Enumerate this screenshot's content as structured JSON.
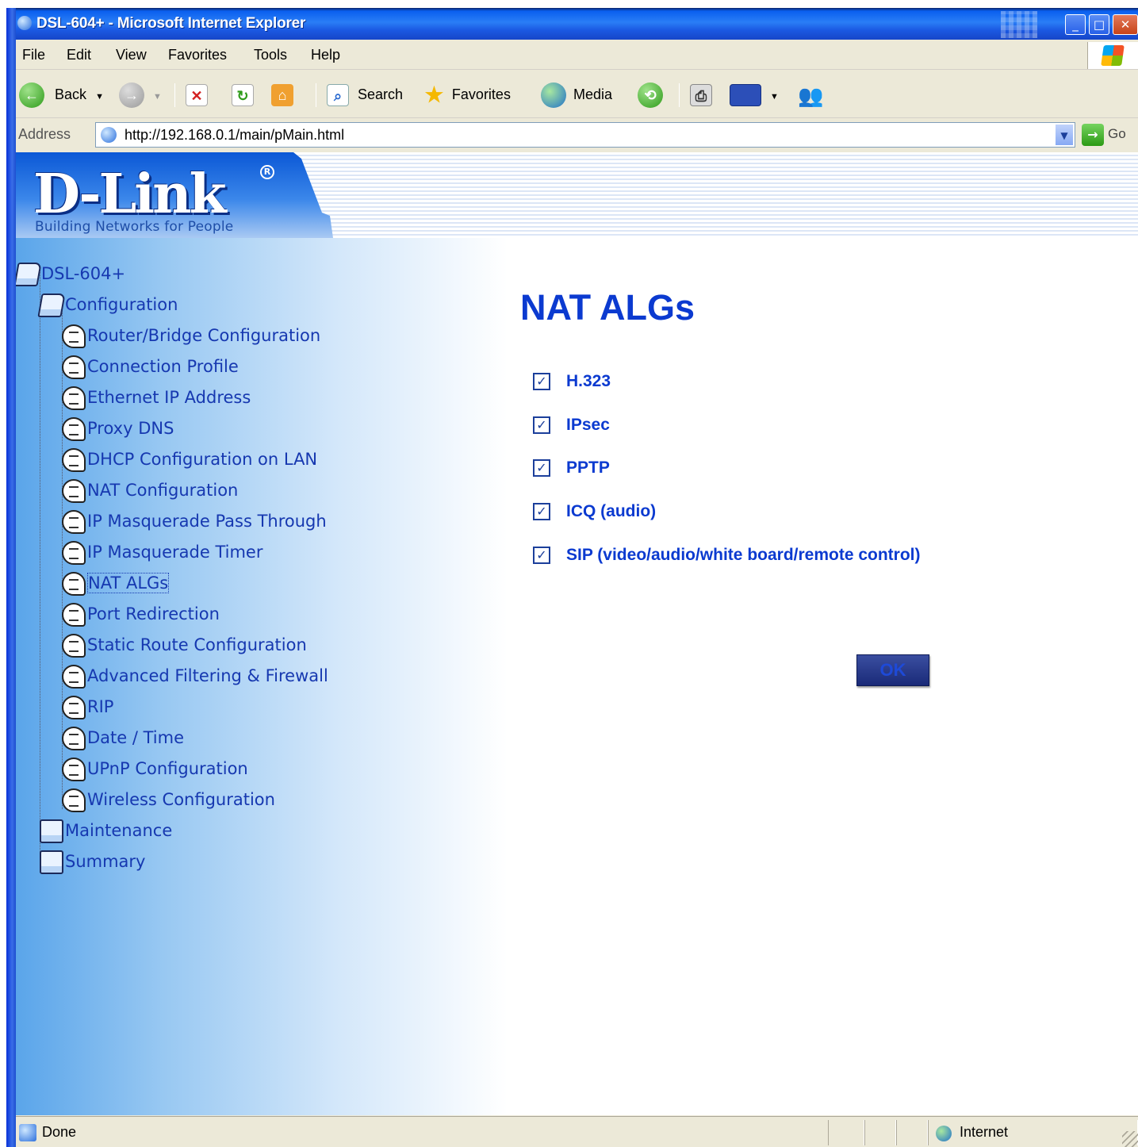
{
  "window": {
    "title": "DSL-604+ - Microsoft Internet Explorer",
    "minimize": "_",
    "maximize": "□",
    "close": "✕"
  },
  "menu": [
    "File",
    "Edit",
    "View",
    "Favorites",
    "Tools",
    "Help"
  ],
  "toolbar": {
    "back_label": "Back",
    "search_label": "Search",
    "favorites_label": "Favorites",
    "media_label": "Media"
  },
  "address": {
    "label": "Address",
    "url": "http://192.168.0.1/main/pMain.html",
    "go_label": "Go"
  },
  "banner": {
    "logo_text": "D-Link",
    "registered": "R",
    "tagline": "Building Networks for People"
  },
  "tree": {
    "root": "DSL-604+",
    "configuration": "Configuration",
    "items": [
      "Router/Bridge Configuration",
      "Connection Profile",
      "Ethernet IP Address",
      "Proxy DNS",
      "DHCP Configuration on LAN",
      "NAT Configuration",
      "IP Masquerade Pass Through",
      "IP Masquerade Timer",
      "NAT ALGs",
      "Port Redirection",
      "Static Route Configuration",
      "Advanced Filtering & Firewall",
      "RIP",
      "Date / Time",
      "UPnP Configuration",
      "Wireless Configuration"
    ],
    "selected_item": "NAT ALGs",
    "maintenance": "Maintenance",
    "summary": "Summary"
  },
  "main": {
    "title": "NAT ALGs",
    "algs": [
      {
        "label": "H.323",
        "checked": true
      },
      {
        "label": "IPsec",
        "checked": true
      },
      {
        "label": "PPTP",
        "checked": true
      },
      {
        "label": "ICQ (audio)",
        "checked": true
      },
      {
        "label": "SIP (video/audio/white board/remote control)",
        "checked": true
      }
    ],
    "ok_label": "OK",
    "check_mark": "✓"
  },
  "status": {
    "text": "Done",
    "zone": "Internet"
  },
  "colors": {
    "link_blue": "#1638b0",
    "title_blue": "#0b3ad0",
    "xp_title_blue": "#1b59e2"
  }
}
